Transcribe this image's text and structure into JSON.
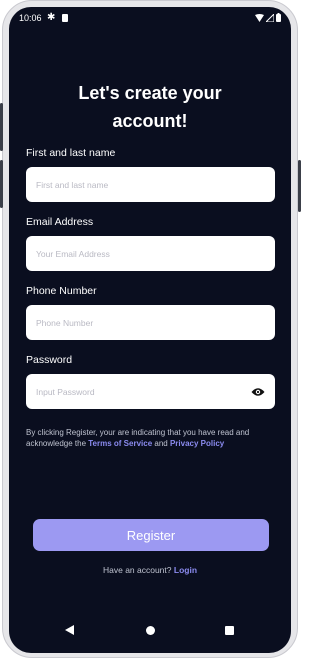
{
  "status_bar": {
    "time": "10:06"
  },
  "title": "Let's create your\naccount!",
  "fields": [
    {
      "label": "First and last name",
      "placeholder": "First and last name"
    },
    {
      "label": "Email Address",
      "placeholder": "Your Email Address"
    },
    {
      "label": "Phone Number",
      "placeholder": "Phone Number"
    },
    {
      "label": "Password",
      "placeholder": "Input Password"
    }
  ],
  "terms": {
    "prefix": "By clicking Register, your are indicating that you have read and acknowledge the ",
    "tos": "Terms of Service",
    "and": " and ",
    "privacy": "Privacy Policy"
  },
  "register_label": "Register",
  "login": {
    "prefix": "Have an account? ",
    "link": "Login"
  },
  "colors": {
    "background": "#0a0e1f",
    "accent": "#9c99f2",
    "link": "#8b8bf0"
  },
  "icons": [
    "gear-icon",
    "sim-card-icon",
    "wifi-icon",
    "signal-icon",
    "battery-icon",
    "eye-icon",
    "back-icon",
    "home-icon",
    "recents-icon"
  ]
}
